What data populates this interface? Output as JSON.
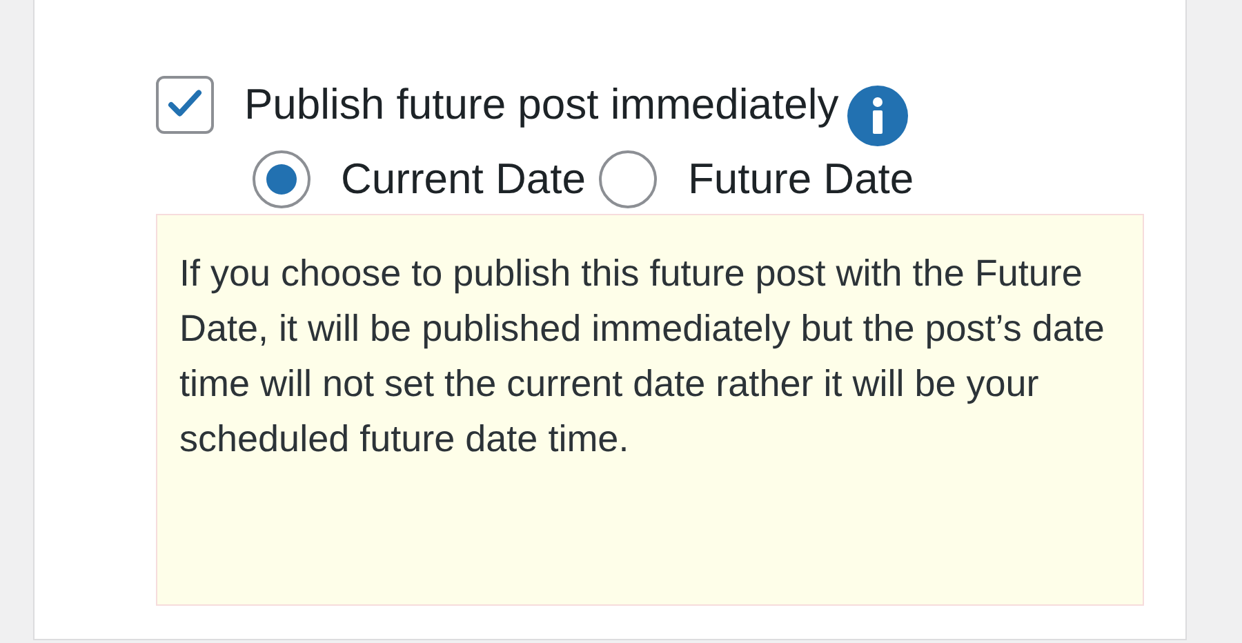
{
  "option": {
    "label": "Publish future post immediately",
    "checked": true
  },
  "radios": [
    {
      "label": "Current Date",
      "selected": true
    },
    {
      "label": "Future Date",
      "selected": false
    }
  ],
  "notice": "If you choose to publish this future post with the Future Date, it will be published immediately but the post’s date time will not set the current date rather it will be your scheduled future date time."
}
